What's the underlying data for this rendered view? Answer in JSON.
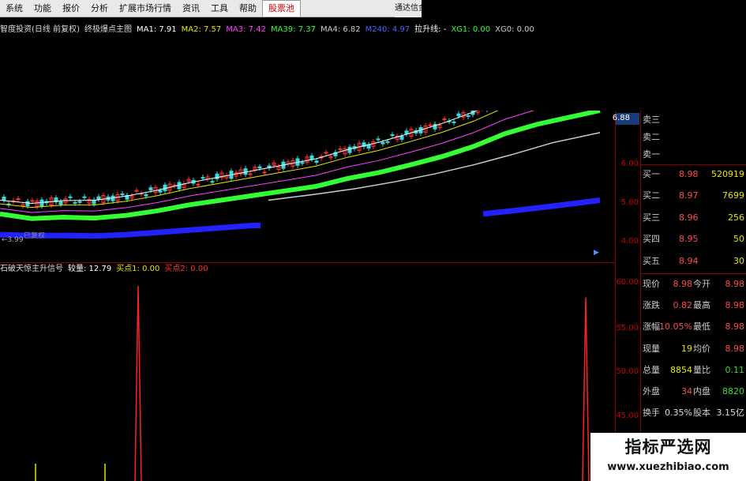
{
  "menu": {
    "items": [
      "系统",
      "功能",
      "报价",
      "分析",
      "扩展市场行情",
      "资讯",
      "工具",
      "帮助",
      "股票池"
    ],
    "active_index": 8,
    "window_title": "通达信金"
  },
  "main_indicator": {
    "stock_label": "智度投资(日线 前复权)",
    "formula": "终极爆点主图",
    "ma1": "MA1: 7.91",
    "ma2": "MA2: 7.57",
    "ma3": "MA3: 7.42",
    "ma39": "MA39: 7.37",
    "ma4": "MA4: 6.82",
    "ma240": "M240: 4.97",
    "lift_line": "拉升线: -",
    "xg1": "XG1: 0.00",
    "xg0": "XG0: 0.00",
    "colors": {
      "ma1": "#ffffff",
      "ma2": "#e6e600",
      "ma3": "#ff44ff",
      "ma39": "#33ff33",
      "ma4": "#cccccc",
      "ma240": "#3333ff",
      "lift_line": "#ffffff"
    }
  },
  "price_axis": {
    "ticks": [
      "6.88",
      "6.00",
      "5.00",
      "4.00"
    ],
    "low_marker": "3.99",
    "low_marker_extra": "已复权"
  },
  "sub_indicator": {
    "name": "石破天惊主升信号",
    "volume": "较量: 12.79",
    "buy1": "买点1: 0.00",
    "buy2": "买点2: 0.00",
    "axis_ticks": [
      "60.00",
      "55.00",
      "50.00",
      "45.00"
    ]
  },
  "order_book": {
    "asks": [
      {
        "label": "卖三",
        "price": "",
        "volume": ""
      },
      {
        "label": "卖二",
        "price": "",
        "volume": ""
      },
      {
        "label": "卖一",
        "price": "",
        "volume": ""
      }
    ],
    "bids": [
      {
        "label": "买一",
        "price": "8.98",
        "volume": "520919"
      },
      {
        "label": "买二",
        "price": "8.97",
        "volume": "7699"
      },
      {
        "label": "买三",
        "price": "8.96",
        "volume": "256"
      },
      {
        "label": "买四",
        "price": "8.95",
        "volume": "50"
      },
      {
        "label": "买五",
        "price": "8.94",
        "volume": "30"
      }
    ]
  },
  "stats": [
    {
      "l1": "现价",
      "v1": "8.98",
      "c1": "red",
      "l2": "今开",
      "v2": "8.98",
      "c2": "red"
    },
    {
      "l1": "涨跌",
      "v1": "0.82",
      "c1": "red",
      "l2": "最高",
      "v2": "8.98",
      "c2": "red"
    },
    {
      "l1": "涨幅",
      "v1": "10.05%",
      "c1": "red",
      "l2": "最低",
      "v2": "8.98",
      "c2": "red"
    },
    {
      "l1": "现量",
      "v1": "19",
      "c1": "yel",
      "l2": "均价",
      "v2": "8.98",
      "c2": "red"
    },
    {
      "l1": "总量",
      "v1": "8854",
      "c1": "yel",
      "l2": "量比",
      "v2": "0.11",
      "c2": "grn"
    },
    {
      "l1": "外盘",
      "v1": "34",
      "c1": "red",
      "l2": "内盘",
      "v2": "8820",
      "c2": "grn"
    },
    {
      "l1": "换手",
      "v1": "0.35%",
      "c1": "wht",
      "l2": "股本",
      "v2": "3.15亿",
      "c2": "wht"
    }
  ],
  "watermark": {
    "title": "指标严选网",
    "url": "www.xuezhibiao.com"
  },
  "chart_data": {
    "type": "line",
    "series": [
      {
        "name": "MA39",
        "color": "#33ff33",
        "x": [
          0,
          40,
          80,
          120,
          160,
          200,
          240,
          280,
          320,
          360,
          400,
          440,
          480,
          520,
          560,
          600,
          640,
          680,
          720,
          760
        ],
        "y": [
          4.65,
          4.55,
          4.58,
          4.56,
          4.62,
          4.72,
          4.85,
          4.95,
          5.05,
          5.15,
          5.25,
          5.42,
          5.55,
          5.72,
          5.9,
          6.12,
          6.4,
          6.6,
          6.75,
          6.9
        ]
      },
      {
        "name": "M240",
        "color": "#2222ff",
        "x": [
          0,
          40,
          80,
          120,
          160,
          200,
          240,
          280,
          320,
          330
        ],
        "y": [
          4.2,
          4.18,
          4.18,
          4.17,
          4.2,
          4.25,
          4.3,
          4.35,
          4.4,
          4.4
        ]
      },
      {
        "name": "M240-right",
        "color": "#2222ff",
        "x": [
          612,
          650,
          700,
          760
        ],
        "y": [
          4.65,
          4.72,
          4.82,
          4.95
        ]
      },
      {
        "name": "MA4",
        "color": "#cccccc",
        "x": [
          340,
          400,
          450,
          500,
          550,
          600,
          650,
          700,
          760
        ],
        "y": [
          4.95,
          5.08,
          5.2,
          5.35,
          5.52,
          5.72,
          5.95,
          6.2,
          6.42
        ]
      }
    ],
    "ylim": [
      3.6,
      6.9
    ],
    "signal_spikes": {
      "x": [
        175,
        742
      ],
      "values": [
        60.0,
        59.0
      ]
    },
    "sub_ylim": [
      43.0,
      62.0
    ]
  }
}
